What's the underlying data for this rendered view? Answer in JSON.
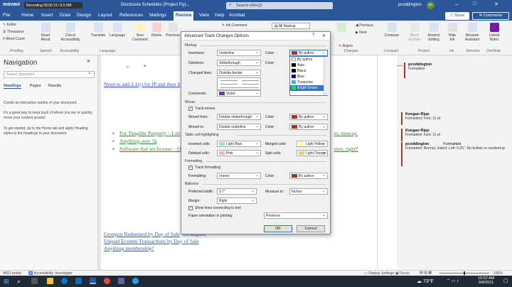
{
  "title_bar": {
    "brand": "movavi",
    "recording": "Recording 00:00:19 / 8.5 MB",
    "doc_title": "Disclosure Schedules (Project Fly)...",
    "search": "Search (Alt+Q)",
    "user": "pcoddington",
    "user_initials": "pc"
  },
  "tabs": [
    "File",
    "Home",
    "Insert",
    "Draw",
    "Design",
    "Layout",
    "References",
    "Mailings",
    "Review",
    "View",
    "Help",
    "Acrobat"
  ],
  "active_tab": "Review",
  "share": "Share",
  "comments_btn": "Comments",
  "ribbon": {
    "editor": "Editor",
    "thesaurus": "Thesaurus",
    "word_count": "Word Count",
    "proofing": "Proofing",
    "read_aloud": "Read Aloud",
    "speech": "Speech",
    "check_accessibility": "Check Accessibility",
    "accessibility": "Accessibility",
    "translate": "Translate",
    "language_btn": "Language",
    "language": "Language",
    "new_comment": "New Comment",
    "delete": "Delete",
    "previous": "Previous",
    "ink_comment": "Ink Comment",
    "all_markup": "All Markup",
    "previous2": "Previous",
    "next": "Next",
    "changes": "Changes",
    "compare": "Compare",
    "block_authors": "Block Authors",
    "restrict_editing": "Restrict Editing",
    "protect": "Protect",
    "hide_ink": "Hide Ink",
    "ink": "Ink",
    "resume_assistant": "Resume Assistant",
    "resume": "Resume",
    "linked_notes": "Linked Notes",
    "onenote": "OneNote",
    "compare_grp": "Compare"
  },
  "nav": {
    "title": "Navigation",
    "search_placeholder": "Search document",
    "tabs": [
      "Headings",
      "Pages",
      "Results"
    ],
    "p1": "Create an interactive outline of your document.",
    "p2": "It's a great way to keep track of where you are or quickly move your content around.",
    "p3": "To get started, go to the Home tab and apply Heading styles to the headings in your document."
  },
  "doc": {
    "line1": "Need to add 2.1(r) for IP and then li",
    "b1": "For Tangible Property – List",
    "b1_tail": "er, runway.",
    "b2": "Anything over 5k",
    "b3": "Software that we license – O",
    "b3_tail": "nies, right?",
    "l4": "Groupon Redeemed by Day of Sale",
    "l4_tail": "not aligned",
    "l5": "Unpaid Ecomm Transactions by Day of Sale",
    "l6": "Anything membership?"
  },
  "comments": [
    {
      "name": "pcoddington",
      "body": "Formatted"
    },
    {
      "name": "Keegan Ripp",
      "body": "Formatted: Font: 11 pt"
    },
    {
      "name": "Keegan Ripp",
      "body": "Formatted: Font: 11 pt"
    },
    {
      "name": "pcoddington",
      "extra": "Formatted",
      "body": "Formatted: Normal, Indent: Left: 0.25\", No bullets or numbering"
    }
  ],
  "dialog": {
    "title": "Advanced Track Changes Options",
    "help": "?",
    "close": "✕",
    "markup": "Markup",
    "insertions_lbl": "Insertions:",
    "insertions": "Underline",
    "deletions_lbl": "Deletions:",
    "deletions": "Strikethrough",
    "changed_lines_lbl": "Changed lines:",
    "changed_lines": "Outside border",
    "comments_lbl": "Comments:",
    "comments_val": "Violet",
    "color_lbl": "Color:",
    "by_author": "By author",
    "color_list": [
      {
        "name": "By author",
        "color": "#ffffff"
      },
      {
        "name": "Auto",
        "color": "#000000"
      },
      {
        "name": "Black",
        "color": "#000000"
      },
      {
        "name": "Blue",
        "color": "#0000ff"
      },
      {
        "name": "Turquoise",
        "color": "#00ccff"
      },
      {
        "name": "Bright Green",
        "color": "#00ff00"
      }
    ],
    "moves": "Moves",
    "track_moves": "Track moves",
    "moved_from_lbl": "Moved from:",
    "moved_from": "Double strikethrough",
    "moved_to_lbl": "Moved to:",
    "moved_to": "Double underline",
    "table_hl": "Table cell highlighting",
    "inserted_cells_lbl": "Inserted cells:",
    "inserted_cells": "Light Blue",
    "merged_cells_lbl": "Merged cells:",
    "merged_cells": "Light Yellow",
    "deleted_cells_lbl": "Deleted cells:",
    "deleted_cells": "Pink",
    "split_cells_lbl": "Split cells:",
    "split_cells": "Light Orange",
    "formatting": "Formatting",
    "track_formatting": "Track formatting",
    "formatting_lbl": "Formatting:",
    "formatting_val": "(none)",
    "balloons": "Balloons",
    "pref_width_lbl": "Preferred width:",
    "pref_width": "3.7\"",
    "measure_lbl": "Measure in:",
    "measure": "Inches",
    "margin_lbl": "Margin:",
    "margin": "Right",
    "show_lines": "Show lines connecting to text",
    "paper_lbl": "Paper orientation in printing:",
    "paper": "Preserve",
    "ok": "OK",
    "cancel": "Cancel"
  },
  "status": {
    "words": "9603 words",
    "accessibility": "Accessibility: Investigate",
    "display": "Display Settings",
    "focus": "Focus",
    "zoom": "100%"
  },
  "taskbar": {
    "temp": "73°F",
    "time": "10:52 AM",
    "date": "9/9/2021"
  },
  "colors": {
    "word_blue": "#2b579a",
    "author_red": "#a2372f",
    "link_blue": "#2e60c8",
    "ins_green": "#2f8f2f",
    "violet": "#6b3fa0",
    "light_blue": "#add8e6",
    "pink": "#f4b6c2",
    "light_yellow": "#ffff99",
    "light_orange": "#ffc680"
  }
}
